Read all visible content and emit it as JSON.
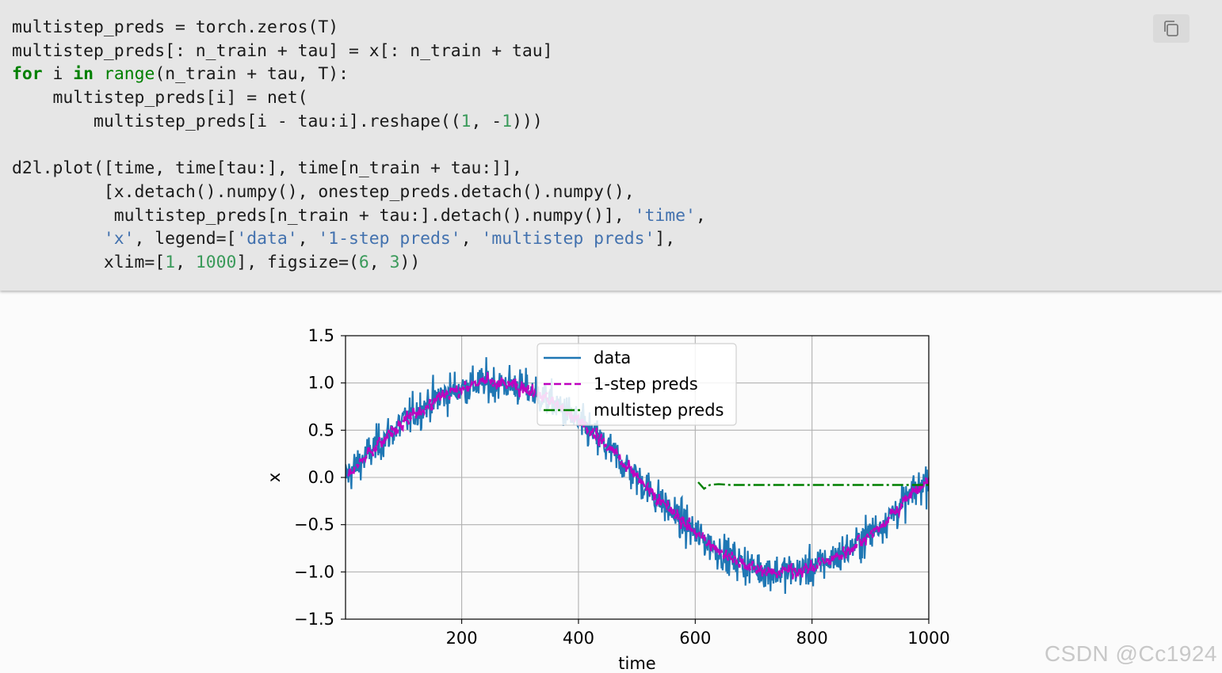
{
  "code": {
    "lines": [
      [
        {
          "t": "multistep_preds = torch.zeros(T)",
          "c": ""
        }
      ],
      [
        {
          "t": "multistep_preds[: n_train + tau] = x[: n_train + tau]",
          "c": ""
        }
      ],
      [
        {
          "t": "for",
          "c": "kw"
        },
        {
          "t": " i ",
          "c": ""
        },
        {
          "t": "in",
          "c": "kw"
        },
        {
          "t": " ",
          "c": ""
        },
        {
          "t": "range",
          "c": "bi"
        },
        {
          "t": "(n_train + tau, T):",
          "c": ""
        }
      ],
      [
        {
          "t": "    multistep_preds[i] = net(",
          "c": ""
        }
      ],
      [
        {
          "t": "        multistep_preds[i - tau:i].reshape((",
          "c": ""
        },
        {
          "t": "1",
          "c": "num"
        },
        {
          "t": ", -",
          "c": ""
        },
        {
          "t": "1",
          "c": "num"
        },
        {
          "t": ")))",
          "c": ""
        }
      ],
      [
        {
          "t": "",
          "c": ""
        }
      ],
      [
        {
          "t": "d2l.plot([time, time[tau:], time[n_train + tau:]],",
          "c": ""
        }
      ],
      [
        {
          "t": "         [x.detach().numpy(), onestep_preds.detach().numpy(),",
          "c": ""
        }
      ],
      [
        {
          "t": "          multistep_preds[n_train + tau:].detach().numpy()], ",
          "c": ""
        },
        {
          "t": "'time'",
          "c": "str"
        },
        {
          "t": ",",
          "c": ""
        }
      ],
      [
        {
          "t": "         ",
          "c": ""
        },
        {
          "t": "'x'",
          "c": "str"
        },
        {
          "t": ", legend=[",
          "c": ""
        },
        {
          "t": "'data'",
          "c": "str"
        },
        {
          "t": ", ",
          "c": ""
        },
        {
          "t": "'1-step preds'",
          "c": "str"
        },
        {
          "t": ", ",
          "c": ""
        },
        {
          "t": "'multistep preds'",
          "c": "str"
        },
        {
          "t": "],",
          "c": ""
        }
      ],
      [
        {
          "t": "         xlim=[",
          "c": ""
        },
        {
          "t": "1",
          "c": "num"
        },
        {
          "t": ", ",
          "c": ""
        },
        {
          "t": "1000",
          "c": "num"
        },
        {
          "t": "], figsize=(",
          "c": ""
        },
        {
          "t": "6",
          "c": "num"
        },
        {
          "t": ", ",
          "c": ""
        },
        {
          "t": "3",
          "c": "num"
        },
        {
          "t": "))",
          "c": ""
        }
      ]
    ]
  },
  "copy_button": {
    "icon": "copy-icon"
  },
  "watermark": "CSDN @Cc1924",
  "chart_data": {
    "type": "line",
    "xlabel": "time",
    "ylabel": "x",
    "xlim": [
      1,
      1000
    ],
    "ylim": [
      -1.5,
      1.5
    ],
    "xticks": [
      200,
      400,
      600,
      800,
      1000
    ],
    "yticks": [
      1.5,
      1.0,
      0.5,
      0.0,
      -0.5,
      -1.0,
      -1.5
    ],
    "ytick_labels": [
      "1.5",
      "1.0",
      "0.5",
      "0.0",
      "−0.5",
      "−1.0",
      "−1.5"
    ],
    "grid": true,
    "legend_position": "upper-center",
    "series": [
      {
        "name": "data",
        "color": "#1f77b4",
        "style": "solid",
        "x_range": [
          1,
          1000
        ],
        "period": 1000,
        "amplitude": 1.0,
        "noise_std": 0.2
      },
      {
        "name": "1-step preds",
        "color": "#bf00bf",
        "style": "dashed",
        "x_range": [
          5,
          1000
        ],
        "period": 1000,
        "amplitude": 1.0,
        "noise_std": 0.1
      },
      {
        "name": "multistep preds",
        "color": "#008000",
        "style": "dashdot",
        "x_range": [
          605,
          1000
        ],
        "points": [
          [
            605,
            -0.05
          ],
          [
            615,
            -0.12
          ],
          [
            625,
            -0.08
          ],
          [
            640,
            -0.07
          ],
          [
            660,
            -0.08
          ],
          [
            700,
            -0.08
          ],
          [
            800,
            -0.08
          ],
          [
            900,
            -0.08
          ],
          [
            1000,
            -0.08
          ]
        ]
      }
    ]
  }
}
